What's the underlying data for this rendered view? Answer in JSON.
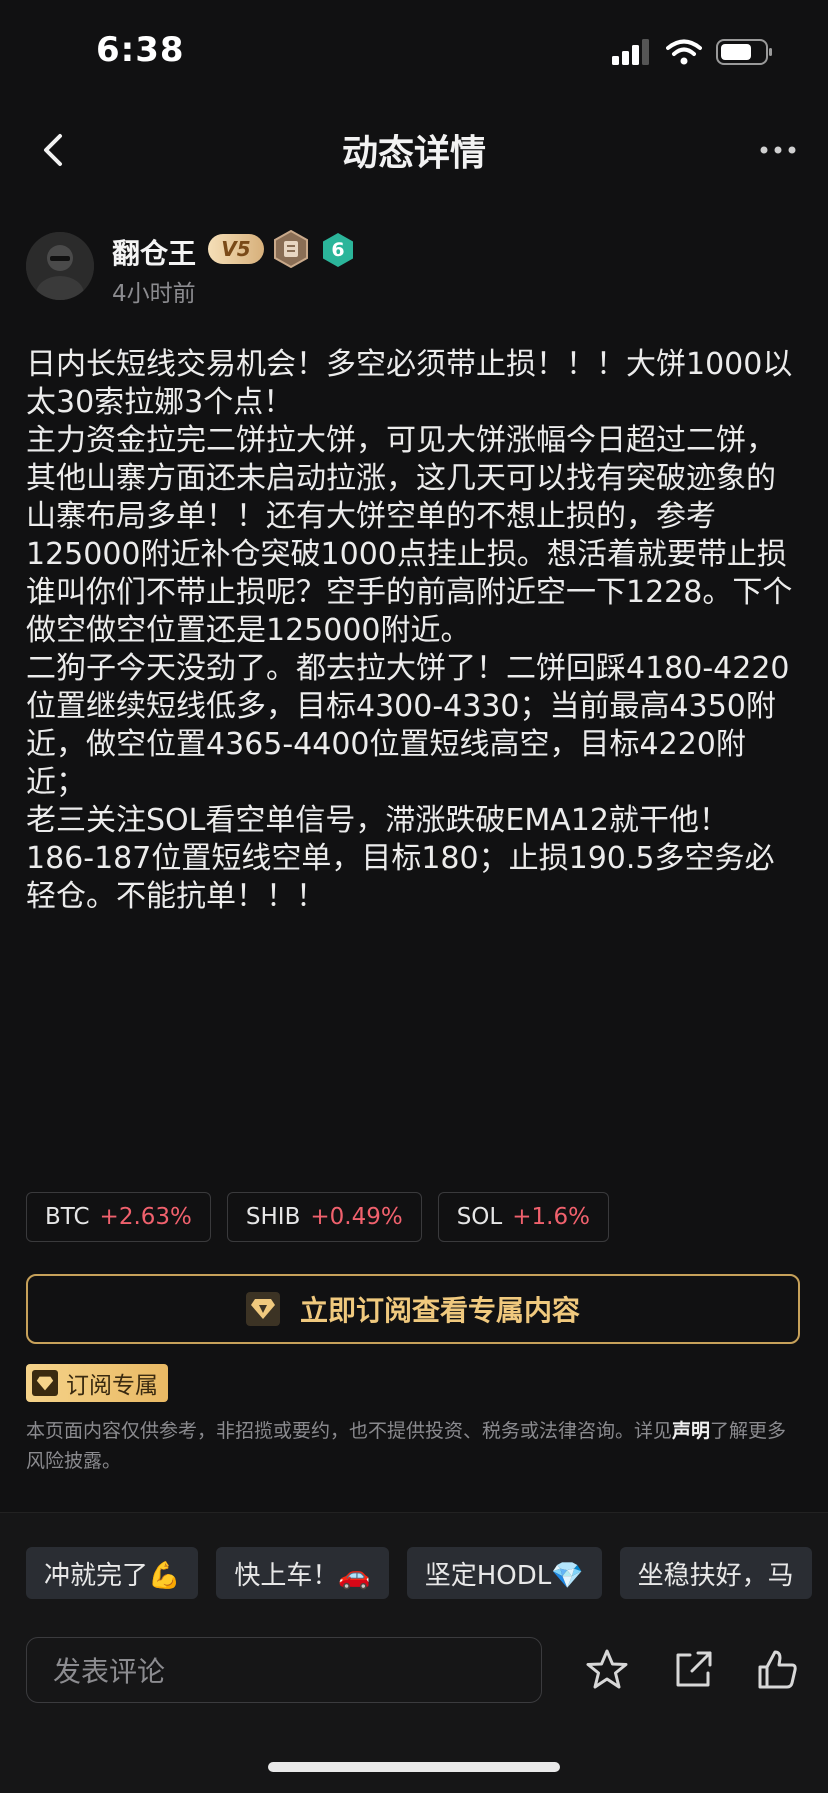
{
  "status_bar": {
    "time": "6:38"
  },
  "nav": {
    "title": "动态详情"
  },
  "author": {
    "name": "翻仓王",
    "vip_badge": "V5",
    "level": "6",
    "posted": "4小时前"
  },
  "post": {
    "lines": [
      "日内长短线交易机会！多空必须带止损！！！大饼1000以太30索拉娜3个点！",
      "主力资金拉完二饼拉大饼，可见大饼涨幅今日超过二饼，其他山寨方面还未启动拉涨，这几天可以找有突破迹象的山寨布局多单！！还有大饼空单的不想止损的，参考125000附近补仓突破1000点挂止损。想活着就要带止损谁叫你们不带止损呢？空手的前高附近空一下1228。下个做空做空位置还是125000附近。",
      "二狗子今天没劲了。都去拉大饼了！二饼回踩4180-4220位置继续短线低多，目标4300-4330；当前最高4350附近，做空位置4365-4400位置短线高空，目标4220附近；",
      "老三关注SOL看空单信号，滞涨跌破EMA12就干他！186-187位置短线空单，目标180；止损190.5多空务必轻仓。不能抗单！！！"
    ]
  },
  "tags": [
    {
      "symbol": "BTC",
      "change": "+2.63%"
    },
    {
      "symbol": "SHIB",
      "change": "+0.49%"
    },
    {
      "symbol": "SOL",
      "change": "+1.6%"
    }
  ],
  "subscribe": {
    "button_label": "立即订阅查看专属内容",
    "tag_label": "订阅专属"
  },
  "disclaimer": {
    "text_before": "本页面内容仅供参考，非招揽或要约，也不提供投资、税务或法律咨询。详见",
    "link": "声明",
    "text_after": "了解更多风险披露。"
  },
  "quick_comments": [
    "冲就完了💪",
    "快上车！🚗",
    "坚定HODL💎",
    "坐稳扶好，马"
  ],
  "comment_box": {
    "placeholder": "发表评论"
  },
  "colors": {
    "gain": "#f0616d",
    "gold": "#c7a15a",
    "background": "#111112"
  }
}
